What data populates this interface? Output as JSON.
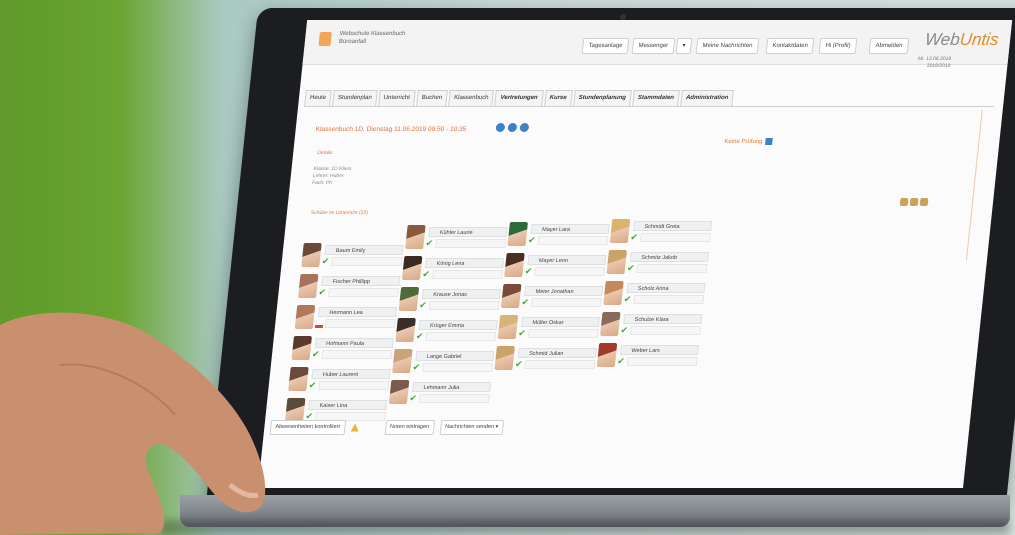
{
  "app": {
    "school_name": "Webschule Klassenbuch",
    "school_sub": "Büroanfall",
    "brand_main": "Web",
    "brand_accent": "Untis",
    "date_line1": "Mi, 12.06.2019",
    "date_line2": "2018/2019"
  },
  "toolbar": {
    "tagesanlage": "Tagesanlage",
    "messenger": "Messenger",
    "dropdown": "▾",
    "nachrichten": "Meine Nachrichten",
    "kontaktdaten": "Kontaktdaten",
    "profil": "Hi (Profil)",
    "abmelden": "Abmelden"
  },
  "tabs": [
    {
      "label": "Heute",
      "bold": false
    },
    {
      "label": "Stundenplan",
      "bold": false
    },
    {
      "label": "Unterricht",
      "bold": false
    },
    {
      "label": "Buchen",
      "bold": false
    },
    {
      "label": "Klassenbuch",
      "bold": false
    },
    {
      "label": "Vertretungen",
      "bold": true
    },
    {
      "label": "Kurse",
      "bold": true
    },
    {
      "label": "Stundenplanung",
      "bold": true
    },
    {
      "label": "Stammdaten",
      "bold": true
    },
    {
      "label": "Administration",
      "bold": true
    }
  ],
  "lesson": {
    "title": "Klassenbuch 1D, Dienstag 11.06.2019 09:50 - 10:35",
    "keine_pruefung": "Keine Prüfung",
    "details_toggle": "Details",
    "info1": "Klasse: 1D Klass",
    "info2": "Lehrer: Huber",
    "info3": "Fach: Ph",
    "students_toggle": "Schüler im Unterricht (22)"
  },
  "students": [
    {
      "name": "Baum Emily",
      "present": true,
      "color": "#6b4a3a"
    },
    {
      "name": "Kühler Laurie",
      "present": true,
      "color": "#8a5a3c"
    },
    {
      "name": "Mayer Lara",
      "present": true,
      "color": "#2d6b3a"
    },
    {
      "name": "Schmidt Greta",
      "present": true,
      "color": "#d9b46a"
    },
    {
      "name": "Fischer Phillipp",
      "present": true,
      "color": "#a9725a"
    },
    {
      "name": "König Lena",
      "present": true,
      "color": "#3a2a22"
    },
    {
      "name": "Mayer Leon",
      "present": true,
      "color": "#4a2e22"
    },
    {
      "name": "Schmitz Jakob",
      "present": true,
      "color": "#c9a36a"
    },
    {
      "name": "Hermann Lea",
      "present": false,
      "color": "#b07a5a"
    },
    {
      "name": "Krause Jonas",
      "present": true,
      "color": "#4f6b3a"
    },
    {
      "name": "Meier Jonathan",
      "present": true,
      "color": "#7a4a3a"
    },
    {
      "name": "Scholz Anna",
      "present": true,
      "color": "#c58a5a"
    },
    {
      "name": "Hofmann Paula",
      "present": true,
      "color": "#5a3a2e"
    },
    {
      "name": "Krüger Emma",
      "present": true,
      "color": "#3a2e2a"
    },
    {
      "name": "Müller Oskar",
      "present": true,
      "color": "#d6b47a"
    },
    {
      "name": "Schulze Klara",
      "present": true,
      "color": "#8a6a5a"
    },
    {
      "name": "Huber Laurent",
      "present": true,
      "color": "#6a4a3e"
    },
    {
      "name": "Lange Gabriel",
      "present": true,
      "color": "#c9a37a"
    },
    {
      "name": "Schmid Julian",
      "present": true,
      "color": "#caa36a"
    },
    {
      "name": "Weber Lars",
      "present": true,
      "color": "#a33a2a"
    },
    {
      "name": "Kaiser Lina",
      "present": true,
      "color": "#5a4a3a"
    },
    {
      "name": "Lehmann Julia",
      "present": true,
      "color": "#7a5a4a"
    }
  ],
  "actions": {
    "abwesenheiten": "Abwesenheiten kontrolliert",
    "noten": "Noten eintragen",
    "nachrichten": "Nachrichten senden ▾"
  },
  "colors": {
    "accent_orange": "#e4733a",
    "check_green": "#3aaa35",
    "icon_blue": "#3f7fc9"
  }
}
